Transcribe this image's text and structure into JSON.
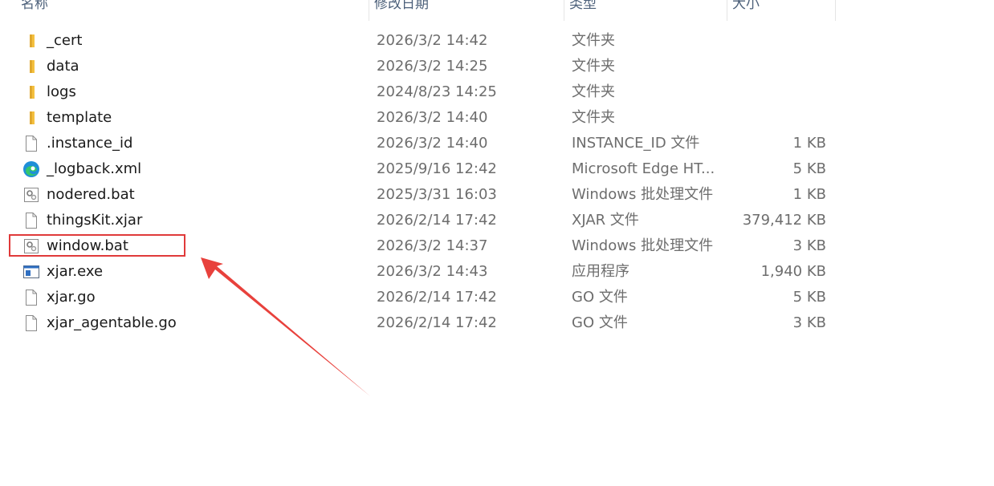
{
  "columns": {
    "name": "名称",
    "date": "修改日期",
    "type": "类型",
    "size": "大小"
  },
  "files": [
    {
      "name": "_cert",
      "date": "2026/3/2 14:42",
      "type": "文件夹",
      "size": "",
      "icon": "folder-icon"
    },
    {
      "name": "data",
      "date": "2026/3/2 14:25",
      "type": "文件夹",
      "size": "",
      "icon": "folder-icon"
    },
    {
      "name": "logs",
      "date": "2024/8/23 14:25",
      "type": "文件夹",
      "size": "",
      "icon": "folder-icon"
    },
    {
      "name": "template",
      "date": "2026/3/2 14:40",
      "type": "文件夹",
      "size": "",
      "icon": "folder-icon"
    },
    {
      "name": ".instance_id",
      "date": "2026/3/2 14:40",
      "type": "INSTANCE_ID 文件",
      "size": "1 KB",
      "icon": "file-icon"
    },
    {
      "name": "_logback.xml",
      "date": "2025/9/16 12:42",
      "type": "Microsoft Edge HT...",
      "size": "5 KB",
      "icon": "edge-icon"
    },
    {
      "name": "nodered.bat",
      "date": "2025/3/31 16:03",
      "type": "Windows 批处理文件",
      "size": "1 KB",
      "icon": "batch-file-icon"
    },
    {
      "name": "thingsKit.xjar",
      "date": "2026/2/14 17:42",
      "type": "XJAR 文件",
      "size": "379,412 KB",
      "icon": "file-icon"
    },
    {
      "name": "window.bat",
      "date": "2026/3/2 14:37",
      "type": "Windows 批处理文件",
      "size": "3 KB",
      "icon": "batch-file-icon"
    },
    {
      "name": "xjar.exe",
      "date": "2026/3/2 14:43",
      "type": "应用程序",
      "size": "1,940 KB",
      "icon": "application-icon"
    },
    {
      "name": "xjar.go",
      "date": "2026/2/14 17:42",
      "type": "GO 文件",
      "size": "5 KB",
      "icon": "file-icon"
    },
    {
      "name": "xjar_agentable.go",
      "date": "2026/2/14 17:42",
      "type": "GO 文件",
      "size": "3 KB",
      "icon": "file-icon"
    }
  ],
  "annotation": {
    "box_color": "#e03a3a",
    "arrow_color": "#e8413c"
  },
  "colors": {
    "folder": "#f4c03f",
    "text": "#1a1a1a",
    "secondary_text": "#6d6d6d",
    "header_text": "#4c607a"
  }
}
